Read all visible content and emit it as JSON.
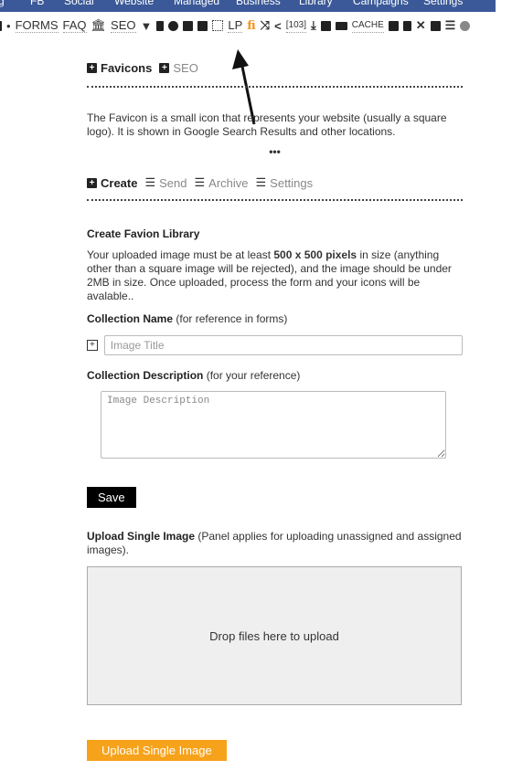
{
  "topnav": {
    "items": [
      "g",
      "FB",
      "Social",
      "Website",
      "Managed",
      "Business",
      "Library",
      "Campaigns",
      "Settings"
    ],
    "background": "#3b5998"
  },
  "toolbar": {
    "lead_icon": "partial-icon",
    "separator": "•",
    "forms": "FORMS",
    "faq": "FAQ",
    "seo": "SEO",
    "lp": "LP",
    "fi": "fi",
    "count": "[103]",
    "cache": "CACHE",
    "icons": [
      "bank-icon",
      "filter-icon",
      "plug-icon",
      "info-icon",
      "inbox-icon",
      "list-icon",
      "frame-icon",
      "favicon-icon",
      "shuffle-icon",
      "share-icon",
      "download-icon",
      "share-square-icon",
      "video-icon",
      "file-import-icon",
      "user-icon",
      "tools-icon",
      "archive-icon",
      "list-ul-icon",
      "pie-chart-icon"
    ]
  },
  "section_tabs": {
    "items": [
      {
        "label": "Favicons",
        "active": true
      },
      {
        "label": "SEO",
        "active": false
      }
    ]
  },
  "intro": {
    "text": "The Favicon is a small icon that represents your website (usually a square logo). It is shown in Google Search Results and other locations.",
    "more": "•••"
  },
  "sub_tabs": {
    "items": [
      {
        "label": "Create",
        "active": true
      },
      {
        "label": "Send",
        "active": false
      },
      {
        "label": "Archive",
        "active": false
      },
      {
        "label": "Settings",
        "active": false
      }
    ]
  },
  "form": {
    "heading": "Create Favion Library",
    "instructions_pre": "Your uploaded image must be at least ",
    "instructions_bold": "500 x 500 pixels",
    "instructions_post": " in size (anything other than a square image will be rejected), and the image should be under 2MB in size. Once uploaded, process the form and your icons will be avalable..",
    "name_label": "Collection Name",
    "name_hint": " (for reference in forms)",
    "name_placeholder": "Image Title",
    "name_value": "",
    "desc_label": "Collection Description",
    "desc_hint": " (for your reference)",
    "desc_placeholder": "Image Description",
    "desc_value": "",
    "save_label": "Save"
  },
  "upload": {
    "label": "Upload Single Image",
    "hint": " (Panel applies for uploading unassigned and assigned images).",
    "dropzone_text": "Drop files here to upload",
    "button_label": "Upload Single Image",
    "button_color": "#f7a21b"
  }
}
